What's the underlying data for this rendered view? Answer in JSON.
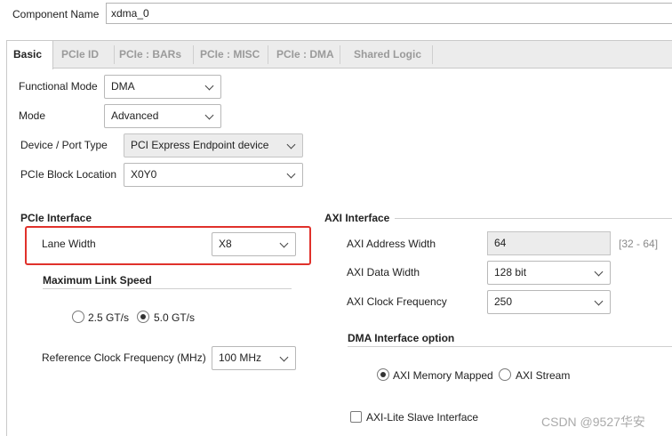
{
  "component": {
    "label": "Component Name",
    "value": "xdma_0"
  },
  "tabs": [
    "Basic",
    "PCIe ID",
    "PCIe : BARs",
    "PCIe : MISC",
    "PCIe : DMA",
    "Shared Logic"
  ],
  "basic": {
    "functional_mode": {
      "label": "Functional Mode",
      "value": "DMA"
    },
    "mode": {
      "label": "Mode",
      "value": "Advanced"
    },
    "device_port_type": {
      "label": "Device / Port Type",
      "value": "PCI Express Endpoint device"
    },
    "block_location": {
      "label": "PCIe Block Location",
      "value": "X0Y0"
    }
  },
  "pcie_interface": {
    "title": "PCIe Interface",
    "lane_width": {
      "label": "Lane Width",
      "value": "X8"
    },
    "max_link_speed": {
      "title": "Maximum Link Speed",
      "options": [
        "2.5 GT/s",
        "5.0 GT/s"
      ],
      "selected": "5.0 GT/s"
    },
    "ref_clock": {
      "label": "Reference Clock Frequency (MHz)",
      "value": "100 MHz"
    }
  },
  "axi_interface": {
    "title": "AXI Interface",
    "address_width": {
      "label": "AXI Address Width",
      "value": "64",
      "range": "[32 - 64]"
    },
    "data_width": {
      "label": "AXI Data Width",
      "value": "128 bit"
    },
    "clock_freq": {
      "label": "AXI Clock Frequency",
      "value": "250"
    }
  },
  "dma_interface": {
    "title": "DMA Interface option",
    "options": [
      "AXI Memory Mapped",
      "AXI Stream"
    ],
    "selected": "AXI Memory Mapped",
    "axi_lite": {
      "label": "AXI-Lite Slave Interface",
      "checked": false
    }
  },
  "watermark": "CSDN @9527华安",
  "colors": {
    "highlight": "#e0312b",
    "tabbar": "#ececec"
  }
}
